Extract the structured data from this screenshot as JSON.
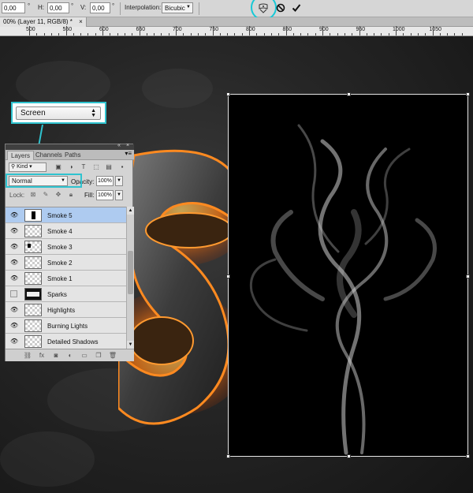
{
  "option_bar": {
    "x_value": "0,00",
    "h_label": "H:",
    "h_value": "0,00",
    "v_label": "V:",
    "v_value": "0,00",
    "degree_symbol": "°",
    "interpolation_label": "Interpolation:",
    "interpolation_value": "Bicubic"
  },
  "document": {
    "tab_title": "00% (Layer 11, RGB/8) *",
    "close_glyph": "×"
  },
  "ruler": {
    "ticks": [
      "500",
      "550",
      "600",
      "650",
      "700",
      "750",
      "800",
      "850",
      "900",
      "950",
      "1000",
      "1050"
    ]
  },
  "callout": {
    "blend_mode": "Screen"
  },
  "layers_panel": {
    "tabs": [
      "Layers",
      "Channels",
      "Paths"
    ],
    "filter_kind": "Kind",
    "blend_mode": "Normal",
    "opacity_label": "Opacity:",
    "opacity_value": "100%",
    "lock_label": "Lock:",
    "fill_label": "Fill:",
    "fill_value": "100%",
    "layers": [
      {
        "name": "Smoke 5",
        "visible": true,
        "selected": true
      },
      {
        "name": "Smoke 4",
        "visible": true,
        "selected": false
      },
      {
        "name": "Smoke 3",
        "visible": true,
        "selected": false
      },
      {
        "name": "Smoke 2",
        "visible": true,
        "selected": false
      },
      {
        "name": "Smoke 1",
        "visible": true,
        "selected": false
      },
      {
        "name": "Sparks",
        "visible": false,
        "selected": false
      },
      {
        "name": "Highlights",
        "visible": true,
        "selected": false
      },
      {
        "name": "Burning Lights",
        "visible": true,
        "selected": false
      },
      {
        "name": "Detailed Shadows",
        "visible": true,
        "selected": false
      }
    ]
  },
  "colors": {
    "callout_accent": "#2fc3cf",
    "selected_layer": "#aecbf0",
    "fire_orange": "#ff7a10"
  }
}
